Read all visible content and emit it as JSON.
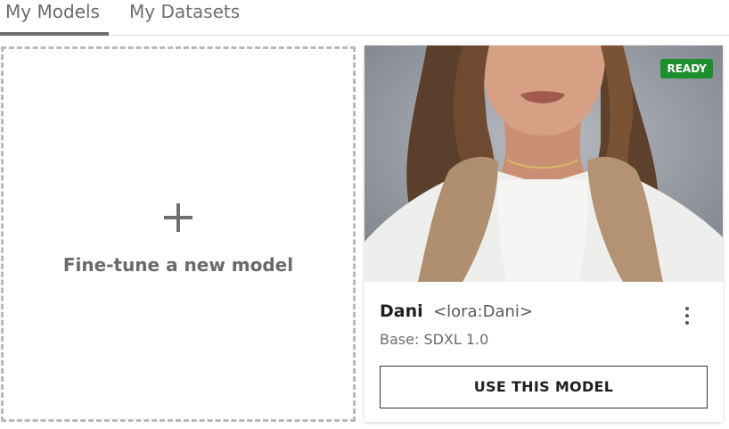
{
  "tabs": [
    {
      "label": "My Models",
      "active": true
    },
    {
      "label": "My Datasets",
      "active": false
    }
  ],
  "new_model_card": {
    "plus_icon": "plus-icon",
    "label": "Fine-tune a new model"
  },
  "model_card": {
    "status": "READY",
    "status_color": "#1e8f2e",
    "name": "Dani",
    "tag": "<lora:Dani>",
    "base": "Base: SDXL 1.0",
    "use_button_label": "USE THIS MODEL",
    "menu_icon": "kebab-menu-icon"
  }
}
